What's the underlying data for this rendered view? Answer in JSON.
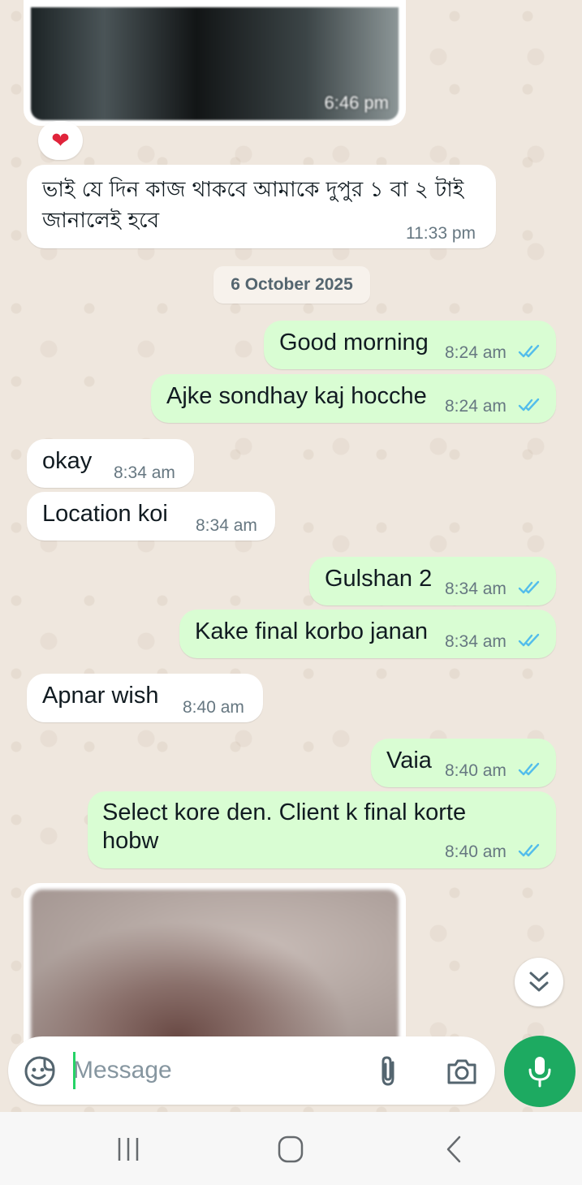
{
  "colors": {
    "chat_background": "#efe7de",
    "incoming_bubble": "#ffffff",
    "outgoing_bubble": "#d9fdd3",
    "timestamp_text": "#667781",
    "read_ticks": "#53bdeb",
    "mic_button": "#1daa61"
  },
  "top_image": {
    "time": "6:46 pm",
    "reaction": "❤"
  },
  "messages": [
    {
      "direction": "in",
      "text": "ভাই যে দিন কাজ থাকবে আমাকে দুপুর ১ বা ২ টাই জানালেই হবে",
      "time": "11:33 pm"
    },
    {
      "direction": "out",
      "text": "Good morning",
      "time": "8:24 am",
      "status": "read"
    },
    {
      "direction": "out",
      "text": "Ajke sondhay kaj hocche",
      "time": "8:24 am",
      "status": "read"
    },
    {
      "direction": "in",
      "text": "okay",
      "time": "8:34 am"
    },
    {
      "direction": "in",
      "text": "Location koi",
      "time": "8:34 am"
    },
    {
      "direction": "out",
      "text": "Gulshan 2",
      "time": "8:34 am",
      "status": "read"
    },
    {
      "direction": "out",
      "text": "Kake final korbo janan",
      "time": "8:34 am",
      "status": "read"
    },
    {
      "direction": "in",
      "text": "Apnar wish",
      "time": "8:40 am"
    },
    {
      "direction": "out",
      "text": "Vaia",
      "time": "8:40 am",
      "status": "read"
    },
    {
      "direction": "out",
      "text": "Select kore den. Client k final korte hobw",
      "time": "8:40 am",
      "status": "read"
    }
  ],
  "date_divider": "6 October 2025",
  "composer": {
    "placeholder": "Message",
    "emoji_icon": "sticker-smiley-icon",
    "attach_icon": "paperclip-icon",
    "camera_icon": "camera-icon",
    "mic_icon": "microphone-icon"
  },
  "scroll_button_icon": "double-chevron-down-icon",
  "navbar": {
    "recent_icon": "recent-apps-icon",
    "home_icon": "home-icon",
    "back_icon": "back-icon"
  }
}
